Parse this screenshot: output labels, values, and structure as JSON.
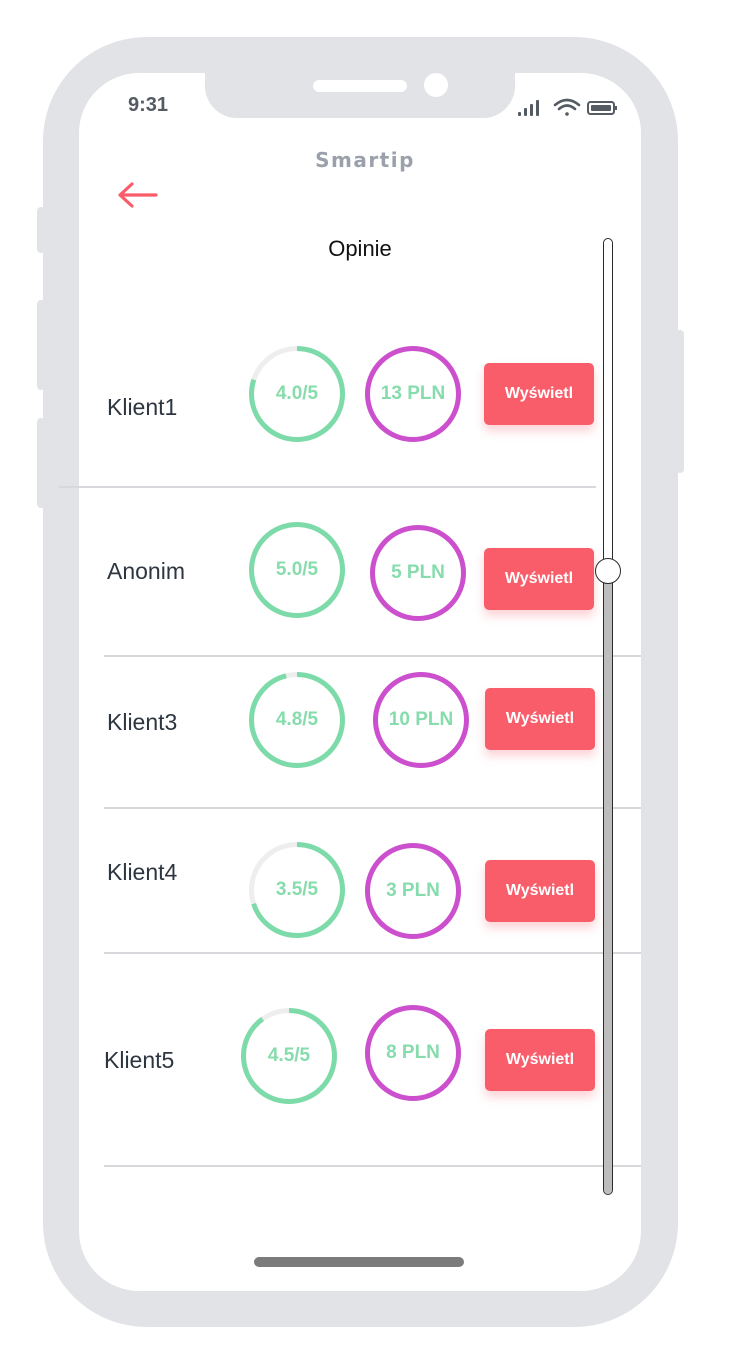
{
  "status_bar": {
    "time": "9:31"
  },
  "header": {
    "app_name": "Smartip",
    "title": "Opinie",
    "back_icon": "arrow-left-icon"
  },
  "colors": {
    "accent": "#f95d6a",
    "rating_ring": "#7ddba9",
    "amount_ring": "#cc4fce",
    "value_text": "#86dcac"
  },
  "button_label": "Wyświetl",
  "rows": [
    {
      "name": "Klient1",
      "rating": "4.0/5",
      "rating_fraction": 0.8,
      "amount": "13 PLN"
    },
    {
      "name": "Anonim",
      "rating": "5.0/5",
      "rating_fraction": 1.0,
      "amount": "5 PLN"
    },
    {
      "name": "Klient3",
      "rating": "4.8/5",
      "rating_fraction": 0.96,
      "amount": "10 PLN"
    },
    {
      "name": "Klient4",
      "rating": "3.5/5",
      "rating_fraction": 0.7,
      "amount": "3 PLN"
    },
    {
      "name": "Klient5",
      "rating": "4.5/5",
      "rating_fraction": 0.9,
      "amount": "8 PLN"
    }
  ],
  "scroll": {
    "position_fraction": 0.35
  }
}
